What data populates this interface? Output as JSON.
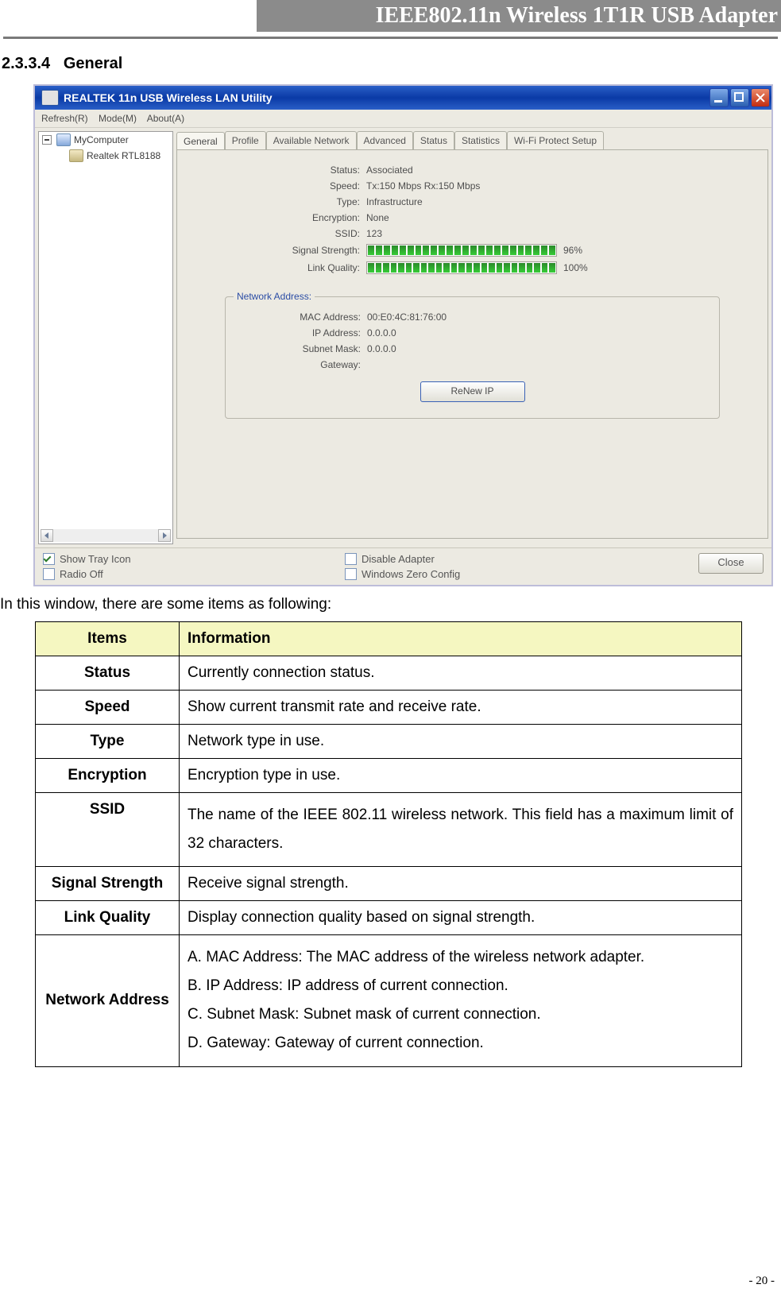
{
  "header": {
    "title": "IEEE802.11n Wireless 1T1R USB Adapter"
  },
  "section": {
    "number": "2.3.3.4",
    "title": "General"
  },
  "window": {
    "title": "REALTEK 11n USB Wireless LAN Utility",
    "menu": {
      "refresh": "Refresh(R)",
      "mode": "Mode(M)",
      "about": "About(A)"
    },
    "tree": {
      "root": "MyComputer",
      "adapter": "Realtek RTL8188"
    },
    "tabs": {
      "general": "General",
      "profile": "Profile",
      "available_network": "Available Network",
      "advanced": "Advanced",
      "status": "Status",
      "statistics": "Statistics",
      "wifi_protect": "Wi-Fi Protect Setup"
    },
    "general": {
      "labels": {
        "status": "Status:",
        "speed": "Speed:",
        "type": "Type:",
        "encryption": "Encryption:",
        "ssid": "SSID:",
        "signal": "Signal Strength:",
        "link": "Link Quality:"
      },
      "values": {
        "status": "Associated",
        "speed": "Tx:150 Mbps Rx:150 Mbps",
        "type": "Infrastructure",
        "encryption": "None",
        "ssid": "123",
        "signal_pct": "96%",
        "link_pct": "100%"
      },
      "network_address": {
        "title": "Network Address:",
        "labels": {
          "mac": "MAC Address:",
          "ip": "IP Address:",
          "subnet": "Subnet Mask:",
          "gateway": "Gateway:"
        },
        "values": {
          "mac": "00:E0:4C:81:76:00",
          "ip": "0.0.0.0",
          "subnet": "0.0.0.0",
          "gateway": ""
        },
        "renew_btn": "ReNew IP"
      }
    },
    "bottom": {
      "show_tray": "Show Tray Icon",
      "radio_off": "Radio Off",
      "disable_adapter": "Disable Adapter",
      "wzc": "Windows Zero Config",
      "close": "Close"
    }
  },
  "caption": "In this window, there are some items as following:",
  "table": {
    "head_items": "Items",
    "head_info": "Information",
    "rows": [
      {
        "item": "Status",
        "info": "Currently connection status."
      },
      {
        "item": "Speed",
        "info": "Show current transmit rate and receive rate."
      },
      {
        "item": "Type",
        "info": "Network type in use."
      },
      {
        "item": "Encryption",
        "info": "Encryption type in use."
      },
      {
        "item": "SSID",
        "info": "The name of the IEEE 802.11 wireless network. This field has a maximum limit of 32 characters."
      },
      {
        "item": "Signal Strength",
        "info": "Receive signal strength."
      },
      {
        "item": "Link Quality",
        "info": "Display connection quality based on signal strength."
      }
    ],
    "network_address": {
      "item": "Network Address",
      "a": "A. MAC Address: The MAC address of the wireless network adapter.",
      "b": "B. IP Address: IP address of current connection.",
      "c": "C. Subnet Mask: Subnet mask of current connection.",
      "d": "D. Gateway: Gateway of current connection."
    }
  },
  "page_number": "- 20 -"
}
